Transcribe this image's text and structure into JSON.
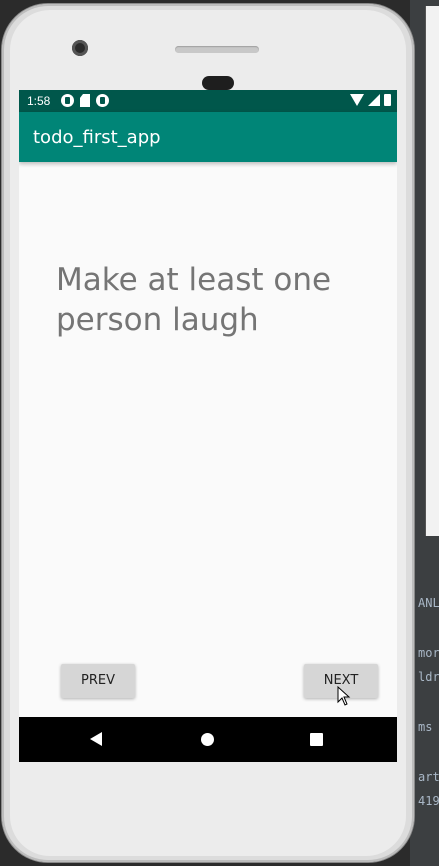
{
  "app": {
    "title": "todo_first_app"
  },
  "status_bar": {
    "time": "1:58",
    "icons": [
      "notification-icon",
      "sd-card-icon",
      "notification-icon",
      "wifi-icon",
      "signal-icon",
      "battery-icon"
    ],
    "color": "#00574b"
  },
  "app_bar": {
    "color": "#008577"
  },
  "main": {
    "todo_text": "Make at least one person laugh"
  },
  "buttons": {
    "prev_label": "PREV",
    "next_label": "NEXT"
  },
  "nav_bar": {
    "items": [
      "back-icon",
      "home-icon",
      "recents-icon"
    ]
  },
  "ide_background": {
    "lines": [
      "ANL",
      "mor",
      "ldr",
      "ms",
      "art",
      "419"
    ]
  }
}
